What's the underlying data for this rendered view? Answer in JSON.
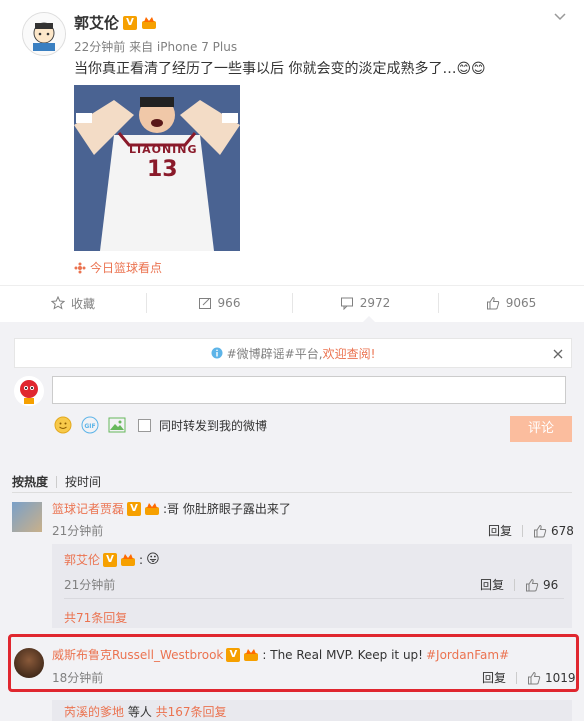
{
  "post": {
    "author": "郭艾伦",
    "meta": "22分钟前 来自 iPhone 7 Plus",
    "text": "当你真正看清了经历了一些事以后 你就会变的淡定成熟多了…",
    "emoji": "😊😊",
    "jersey_text": "LIAONING",
    "jersey_number": "13",
    "source": "今日篮球看点"
  },
  "actions": {
    "collect": "收藏",
    "repost": "966",
    "comment": "2972",
    "like": "9065"
  },
  "notice": {
    "text_gray": "#微博辟谣#平台,",
    "text_orange": "欢迎查阅!"
  },
  "composer": {
    "input_value": "",
    "also_repost_label": "同时转发到我的微博",
    "submit_label": "评论"
  },
  "sort": {
    "hot": "按热度",
    "time": "按时间"
  },
  "comments": [
    {
      "user": "篮球记者贾磊",
      "text": ":哥 你肚脐眼子露出来了",
      "time": "21分钟前",
      "reply": "回复",
      "likes": "678",
      "replies": [
        {
          "user": "郭艾伦",
          "text": ":",
          "emoji": "😛",
          "time": "21分钟前",
          "reply": "回复",
          "likes": "96"
        }
      ],
      "more": "共71条回复"
    },
    {
      "user": "威斯布鲁克Russell_Westbrook",
      "text": ": The Real MVP. Keep it up! ",
      "hashtag": "#JordanFam#",
      "time": "18分钟前",
      "reply": "回复",
      "likes": "1019"
    }
  ],
  "footer": {
    "user": "芮溪的爹地",
    "mid": " 等人 ",
    "count": "共167条回复"
  },
  "colors": {
    "accent": "#eb7350",
    "highlight": "#e0272f",
    "badge": "#f6a000"
  }
}
